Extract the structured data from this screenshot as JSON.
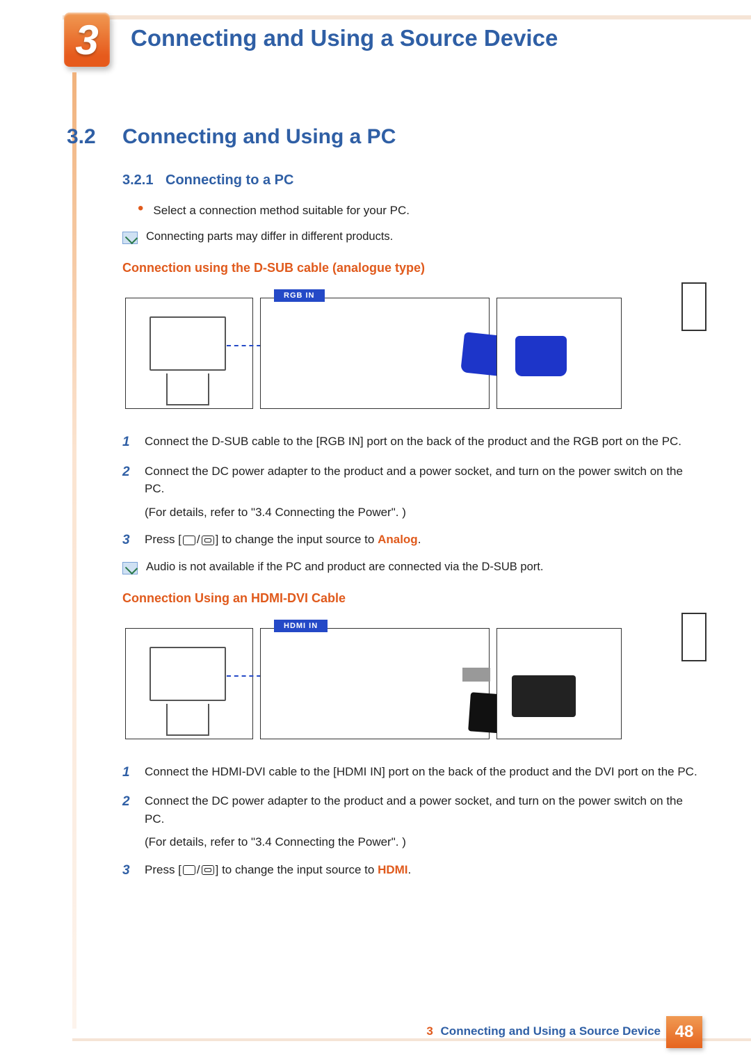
{
  "chapter": {
    "number": "3",
    "title": "Connecting and Using a Source Device"
  },
  "section": {
    "number": "3.2",
    "title": "Connecting and Using a PC"
  },
  "subsection": {
    "number": "3.2.1",
    "title": "Connecting to a PC"
  },
  "bullet1": "Select a connection method suitable for your PC.",
  "note1": "Connecting parts may differ in different products.",
  "methodA": {
    "heading": "Connection using the D-SUB cable (analogue type)",
    "port_label": "RGB IN",
    "steps": {
      "s1": "Connect the D-SUB cable to the [RGB IN] port on the back of the product and the RGB port on the PC.",
      "s2a": "Connect the DC power adapter to the product and a power socket, and turn on the power switch on the PC.",
      "s2b": "(For details, refer to \"3.4 Connecting the Power\". )",
      "s3_pre": "Press [",
      "s3_slash": "/",
      "s3_mid": "] to change the input source to ",
      "s3_kw": "Analog",
      "s3_post": "."
    },
    "note": "Audio is not available if the PC and product are connected via the D-SUB port."
  },
  "methodB": {
    "heading": "Connection Using an HDMI-DVI Cable",
    "port_label": "HDMI IN",
    "steps": {
      "s1": "Connect the HDMI-DVI cable to the [HDMI IN] port on the back of the product and the DVI port on the PC.",
      "s2a": "Connect the DC power adapter to the product and a power socket, and turn on the power switch on the PC.",
      "s2b": "(For details, refer to \"3.4 Connecting the Power\". )",
      "s3_pre": "Press [",
      "s3_slash": "/",
      "s3_mid": "] to change the input source to ",
      "s3_kw": "HDMI",
      "s3_post": "."
    }
  },
  "footer": {
    "chapter_num": "3",
    "chapter_title": "Connecting and Using a Source Device",
    "page": "48"
  }
}
